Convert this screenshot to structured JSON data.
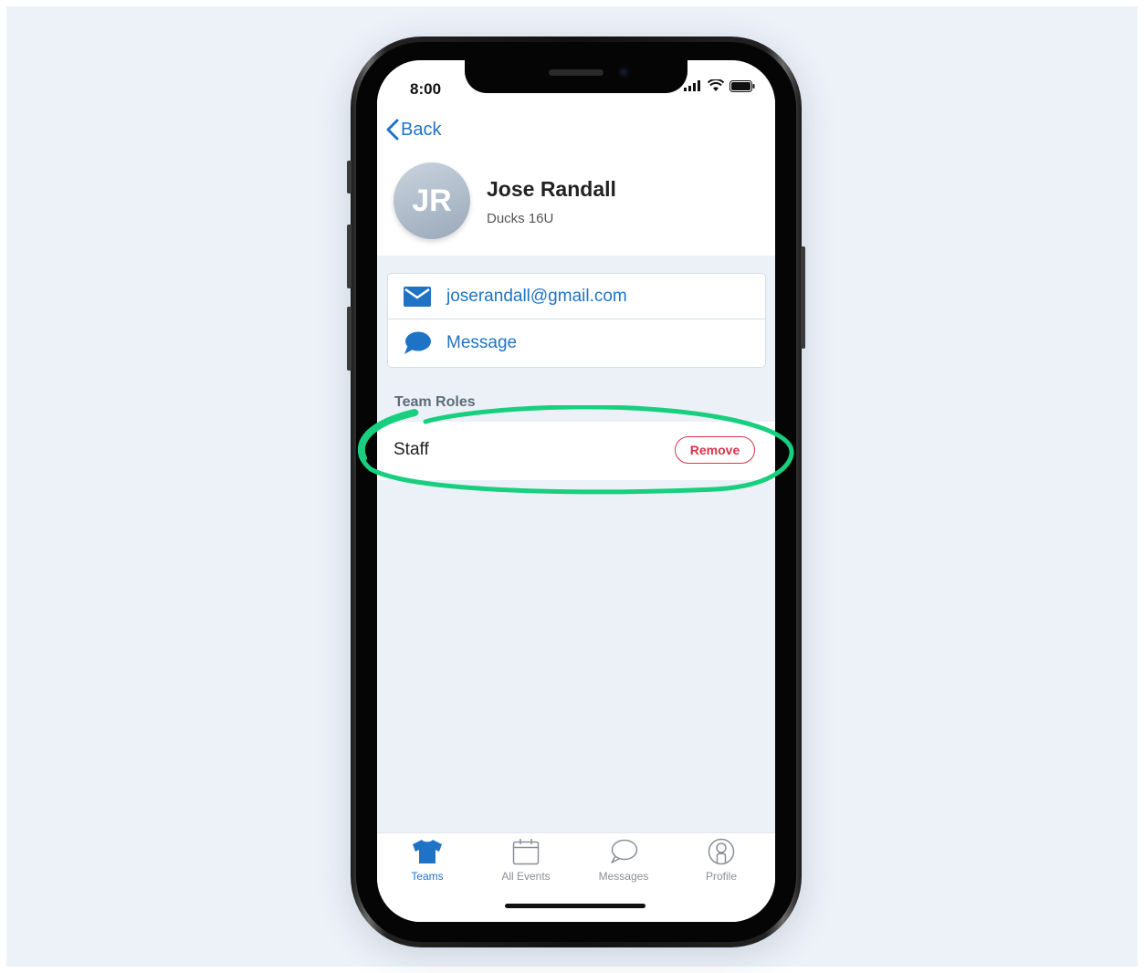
{
  "status_bar": {
    "time": "8:00"
  },
  "nav": {
    "back_label": "Back"
  },
  "profile": {
    "initials": "JR",
    "name": "Jose Randall",
    "team": "Ducks 16U"
  },
  "contact": {
    "email": "joserandall@gmail.com",
    "message_label": "Message"
  },
  "roles": {
    "section_title": "Team Roles",
    "items": [
      {
        "label": "Staff",
        "action_label": "Remove"
      }
    ]
  },
  "tabbar": {
    "tabs": [
      {
        "label": "Teams",
        "icon": "jersey-icon",
        "active": true
      },
      {
        "label": "All Events",
        "icon": "calendar-icon",
        "active": false
      },
      {
        "label": "Messages",
        "icon": "chat-bubble-icon",
        "active": false
      },
      {
        "label": "Profile",
        "icon": "profile-icon",
        "active": false
      }
    ]
  },
  "colors": {
    "accent": "#1f73c7",
    "danger": "#d6334a",
    "highlight": "#17cf7e",
    "background": "#edf2f9"
  }
}
